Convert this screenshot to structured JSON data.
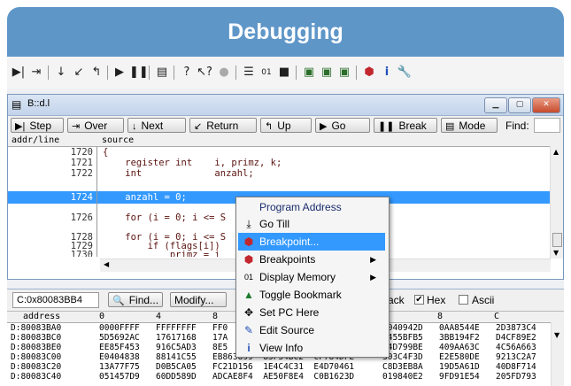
{
  "page_title": "Debugging",
  "main_toolbar": {
    "icons": [
      "step-icon",
      "step-over-icon",
      "next-icon",
      "return-icon",
      "up-icon",
      "go-icon",
      "break-icon",
      "mode-icon",
      "help-icon",
      "context-help-icon",
      "stop-icon",
      "list-icon",
      "memory-icon",
      "register-icon",
      "window-icon-a",
      "window-icon-b",
      "window-icon-c",
      "breakpoint-icon",
      "info-icon",
      "settings-icon"
    ]
  },
  "window": {
    "title": "B::d.l",
    "buttons": {
      "step": "Step",
      "over": "Over",
      "next": "Next",
      "return": "Return",
      "up": "Up",
      "go": "Go",
      "break": "Break",
      "mode": "Mode"
    },
    "find_label": "Find:",
    "columns": {
      "addr": "addr/line",
      "source": "source"
    },
    "lines": [
      {
        "ln": "1720",
        "src": "{"
      },
      {
        "ln": "1721",
        "src": "    register int    i, primz, k;"
      },
      {
        "ln": "1722",
        "src": "    int             anzahl;"
      },
      {
        "ln": "",
        "src": ""
      },
      {
        "ln": "1724",
        "src": "    anzahl = 0;"
      },
      {
        "ln": "",
        "src": ""
      },
      {
        "ln": "1726",
        "src": "    for (i = 0; i <= S"
      },
      {
        "ln": "",
        "src": ""
      },
      {
        "ln": "1728",
        "src": "    for (i = 0; i <= S"
      },
      {
        "ln": "1729",
        "src": "        if (flags[i])"
      },
      {
        "ln": "1730",
        "src": "            primz = i"
      }
    ],
    "selected_index": 4
  },
  "dump": {
    "address": "C:0x80083BB4",
    "find_button": "Find...",
    "modify_button": "Modify...",
    "options": [
      {
        "label": "ack",
        "checked": true
      },
      {
        "label": "Hex",
        "checked": true
      },
      {
        "label": "Ascii",
        "checked": false
      }
    ],
    "headers": {
      "address": "address",
      "c0": "0",
      "c4": "4",
      "c8": "8",
      "c8b": "8",
      "cC": "C"
    },
    "rows": [
      {
        "addr": "D:80083BA0",
        "c1": "0000FFFF",
        "c2": "FFFFFFFF",
        "c3": "FF0",
        "c4": "0040942D",
        "c5": "0AA8544E",
        "c6": "2D3873C4"
      },
      {
        "addr": "D:80083BC0",
        "c1": "5D5692AC",
        "c2": "17617168",
        "c3": "17A",
        "c4": "7455BFB5",
        "c5": "3BB194F2",
        "c6": "D4CF89E2"
      },
      {
        "addr": "D:80083BE0",
        "c1": "EE85F453",
        "c2": "916C5AD3",
        "c3": "8E5",
        "c4": "D4D799BE",
        "c5": "409AA63C",
        "c6": "4C56A663"
      },
      {
        "addr": "D:80083C00",
        "c1": "E0404838",
        "c2": "88141C55",
        "c3": "EB863899  83F34BC2  CF784DFE",
        "c4": "303C4F3D",
        "c5": "E2E580DE",
        "c6": "9213C2A7"
      },
      {
        "addr": "D:80083C20",
        "c1": "13A77F75",
        "c2": "D0B5CA05",
        "c3": "FC21D156  1E4C4C31  E4D70461",
        "c4": "C8D3EB8A",
        "c5": "19D5A61D",
        "c6": "40D8F714"
      },
      {
        "addr": "D:80083C40",
        "c1": "051457D9",
        "c2": "60DD589D",
        "c3": "ADCAE8F4  AE50F8E4  C0B1623D",
        "c4": "019840E2",
        "c5": "9FD91E54",
        "c6": "205FD793"
      }
    ]
  },
  "context_menu": {
    "header": "Program Address",
    "items": [
      {
        "label": "Go Till",
        "icon": "go-till-icon",
        "submenu": false,
        "highlighted": false
      },
      {
        "label": "Breakpoint...",
        "icon": "breakpoint-icon",
        "submenu": false,
        "highlighted": true
      },
      {
        "label": "Breakpoints",
        "icon": "breakpoints-icon",
        "submenu": true,
        "highlighted": false
      },
      {
        "label": "Display Memory",
        "icon": "memory-icon",
        "submenu": true,
        "highlighted": false
      },
      {
        "label": "Toggle Bookmark",
        "icon": "bookmark-icon",
        "submenu": false,
        "highlighted": false
      },
      {
        "label": "Set PC Here",
        "icon": "set-pc-icon",
        "submenu": false,
        "highlighted": false
      },
      {
        "label": "Edit Source",
        "icon": "edit-source-icon",
        "submenu": false,
        "highlighted": false
      },
      {
        "label": "View Info",
        "icon": "info-icon",
        "submenu": false,
        "highlighted": false
      }
    ]
  },
  "colors": {
    "frame": "#5f96c8",
    "selection": "#3399ff",
    "source_text": "#5a1410"
  }
}
